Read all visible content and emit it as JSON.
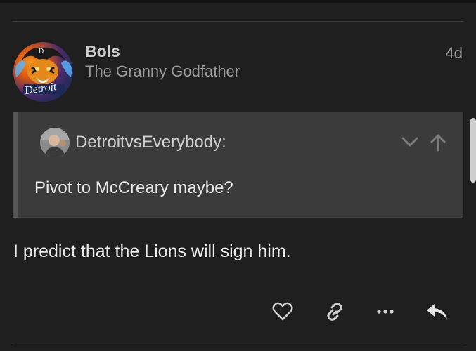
{
  "post": {
    "author": "Bols",
    "author_title": "The Granny Godfather",
    "date": "4d",
    "avatar_text": "Detroit",
    "quote": {
      "author": "DetroitvsEverybody:",
      "text": "Pivot to McCreary maybe?"
    },
    "body": "I predict that the Lions will sign him."
  },
  "icons": {
    "like": "heart-icon",
    "copy_link": "link-icon",
    "more": "ellipsis-icon",
    "reply": "reply-icon",
    "expand_quote": "chevron-down-icon",
    "go_to_quoted": "arrow-up-icon"
  },
  "colors": {
    "background": "#1f1f1f",
    "quote_background": "#3b3b3b",
    "quote_border": "#555555",
    "text_primary": "#e9e9e9",
    "text_muted": "#9a9a9a",
    "icon": "#cfcfcf"
  }
}
